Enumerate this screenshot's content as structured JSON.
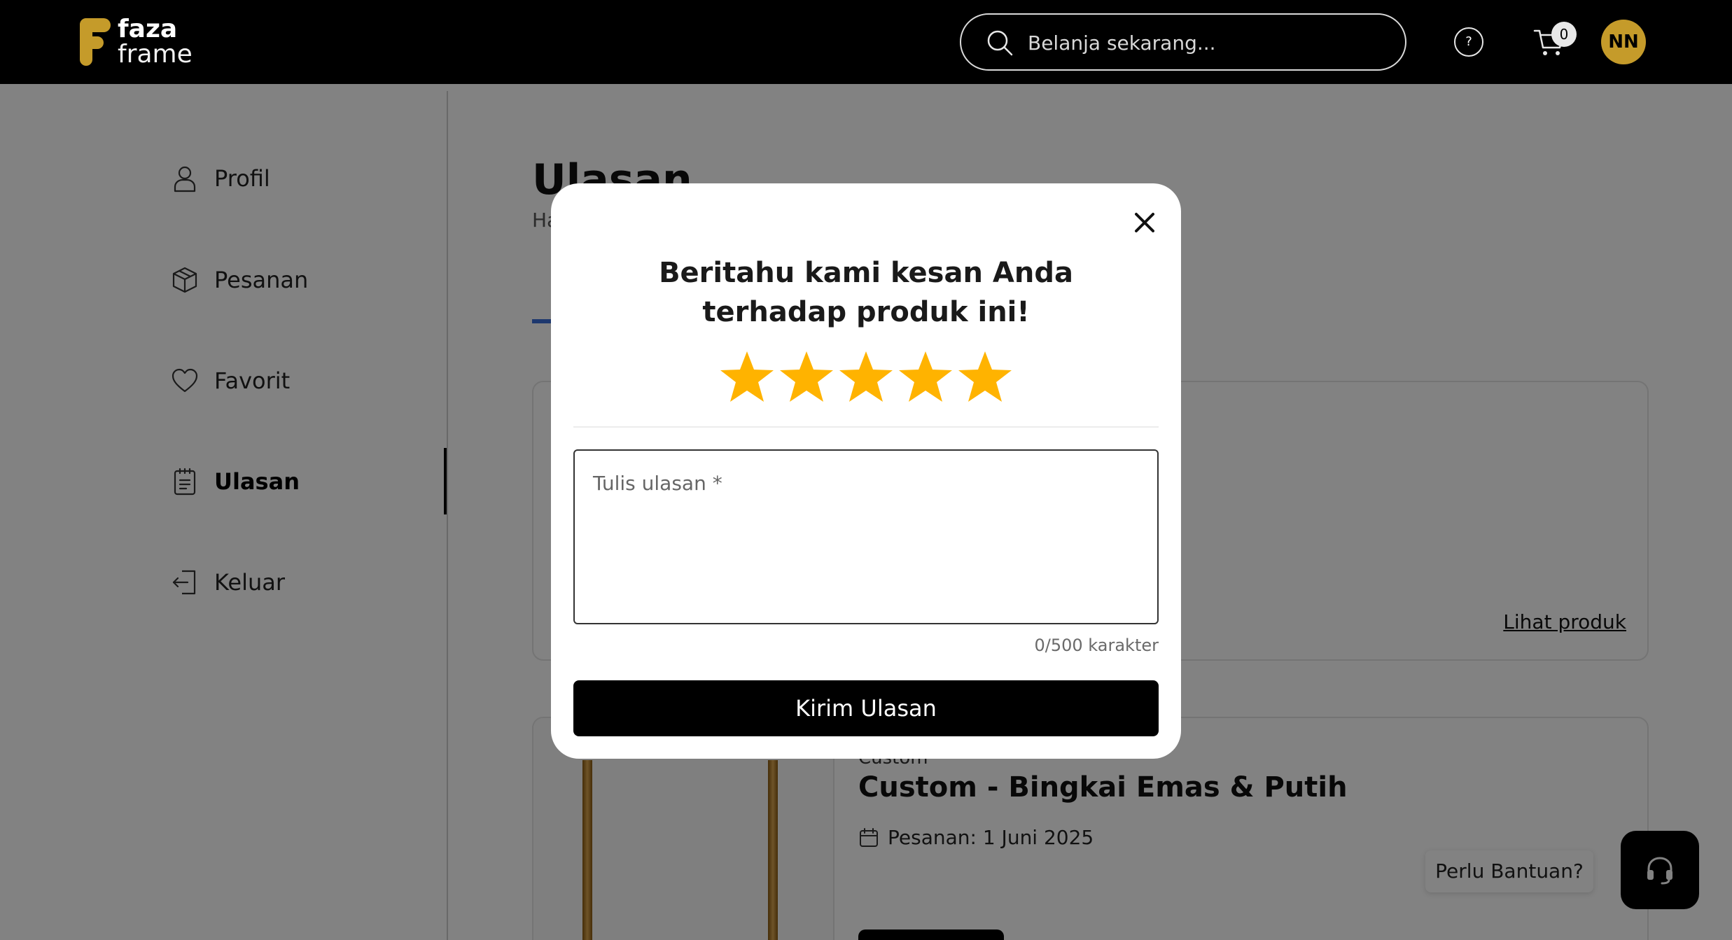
{
  "header": {
    "logo_line1": "faza",
    "logo_line2": "frame",
    "search_placeholder": "Belanja sekarang...",
    "help_label": "?",
    "cart_count": "0",
    "avatar_initials": "NN"
  },
  "sidebar": {
    "items": [
      {
        "label": "Profil",
        "icon": "user-icon"
      },
      {
        "label": "Pesanan",
        "icon": "box-icon"
      },
      {
        "label": "Favorit",
        "icon": "heart-icon"
      },
      {
        "label": "Ulasan",
        "icon": "clipboard-icon",
        "active": true
      },
      {
        "label": "Keluar",
        "icon": "logout-icon"
      }
    ]
  },
  "main": {
    "title": "Ulasan",
    "breadcrumb": "Ha",
    "cards": [
      {
        "link_label": "Lihat produk"
      },
      {
        "category": "Custom",
        "title": "Custom - Bingkai Emas & Putih",
        "date_label": "Pesanan: 1 Juni 2025"
      }
    ]
  },
  "help_widget": {
    "label": "Perlu Bantuan?"
  },
  "modal": {
    "title": "Beritahu kami kesan Anda terhadap produk ini!",
    "rating": 5,
    "max_rating": 5,
    "review_placeholder": "Tulis ulasan *",
    "review_value": "",
    "char_count": "0/500 karakter",
    "submit_label": "Kirim Ulasan"
  },
  "colors": {
    "brand_gold": "#c59b2a",
    "star_fill": "#ffb300",
    "tab_accent": "#3a6fd8",
    "primary_button": "#000000"
  }
}
